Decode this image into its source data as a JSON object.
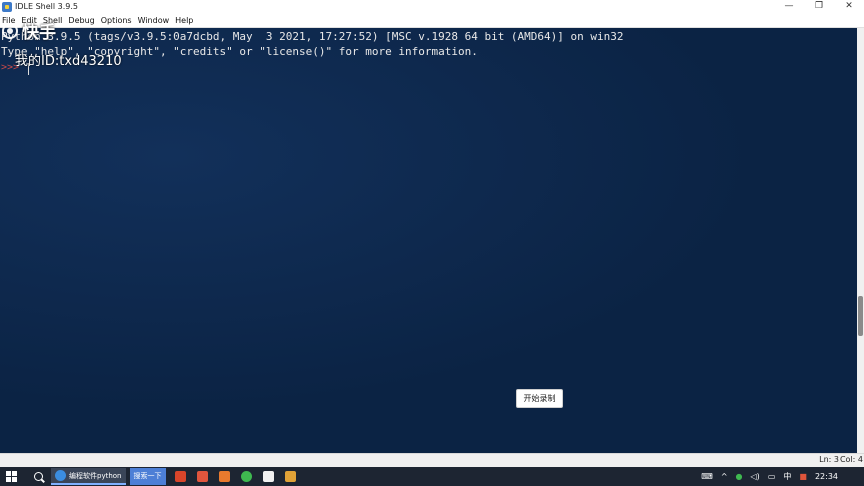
{
  "window": {
    "title": "IDLE Shell 3.9.5",
    "minimize_glyph": "—",
    "restore_glyph": "❐",
    "close_glyph": "✕"
  },
  "menu": {
    "items": [
      "File",
      "Edit",
      "Shell",
      "Debug",
      "Options",
      "Window",
      "Help"
    ]
  },
  "shell": {
    "line1": "Python 3.9.5 (tags/v3.9.5:0a7dcbd, May  3 2021, 17:27:52) [MSC v.1928 64 bit (AMD64)] on win32",
    "line2": "Type \"help\", \"copyright\", \"credits\" or \"license()\" for more information.",
    "prompt": ">>>"
  },
  "watermark": {
    "brand": "快手",
    "id_text": "我的ID:txd43210"
  },
  "record_button": {
    "label": "开始录制"
  },
  "status": {
    "ln": "Ln: 3",
    "col": "Col: 4"
  },
  "taskbar": {
    "task_label": "编程软件python",
    "search_label": "搜索一下",
    "ime": "中",
    "time": "22:34"
  },
  "colors": {
    "shell_bg": "#0b2344",
    "prompt": "#c94a4a",
    "taskbar": "#1d2532"
  }
}
